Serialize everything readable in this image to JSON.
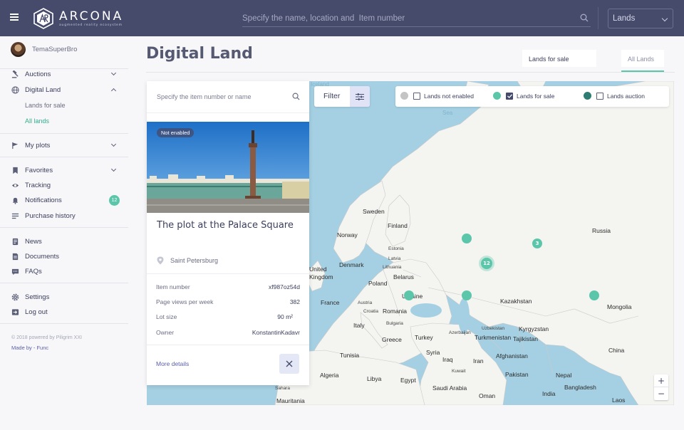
{
  "header": {
    "logo_name": "ARCONA",
    "logo_tagline": "augmented reality ecosystem",
    "search_placeholder": "Specify the name, location and  Item number",
    "lands_select": "Lands"
  },
  "user": {
    "name": "TemaSuperBro"
  },
  "sidebar": {
    "auctions": "Auctions",
    "digital_land": "Digital Land",
    "lands_for_sale": "Lands for sale",
    "all_lands": "All lands",
    "my_plots": "My plots",
    "favorites": "Favorites",
    "tracking": "Tracking",
    "notifications": "Notifications",
    "notifications_count": "12",
    "purchase_history": "Purchase history",
    "news": "News",
    "documents": "Documents",
    "faqs": "FAQs",
    "settings": "Settings",
    "log_out": "Log out",
    "copyright": "© 2018 powered by Piligrim XXI",
    "made_by_prefix": "Made by  -",
    "made_by": "Func"
  },
  "page": {
    "title": "Digital Land",
    "tab_for_sale": "Lands for sale",
    "tab_all": "All Lands"
  },
  "panel": {
    "search_placeholder": "Specify the item number or name",
    "badge": "Not enabled",
    "title": "The plot at the Palace Square",
    "location": "Saint Petersburg",
    "rows": [
      {
        "label": "Item number",
        "value": "xf987oz54d"
      },
      {
        "label": "Page views per week",
        "value": "382"
      },
      {
        "label": "Lot size",
        "value": "90  m²"
      },
      {
        "label": "Owner",
        "value": "KonstantinKadavr"
      }
    ],
    "more_details": "More details"
  },
  "filter": {
    "label": "Filter"
  },
  "legend": {
    "not_enabled": "Lands not enabled",
    "for_sale": "Lands for sale",
    "auction": "Lands auction",
    "colors": {
      "not_enabled": "#c4c4c4",
      "for_sale": "#5cc6aa",
      "auction": "#2f7d72"
    }
  },
  "map": {
    "labels": {
      "sweden": "Sweden",
      "finland": "Finland",
      "norway": "Norway",
      "estonia": "Estonia",
      "latvia": "Latvia",
      "lithuania": "Lithuania",
      "denmark": "Denmark",
      "belarus": "Belarus",
      "united": "United",
      "kingdom": "Kingdom",
      "poland": "Poland",
      "ukraine": "Ukraine",
      "france": "France",
      "austria": "Austria",
      "croatia": "Croatia",
      "romania": "Romania",
      "italy": "Italy",
      "bulgaria": "Bulgaria",
      "greece": "Greece",
      "turkey": "Turkey",
      "tunisia": "Tunisia",
      "syria": "Syria",
      "iraq": "Iraq",
      "iran": "Iran",
      "kuwait": "Kuwait",
      "azerbaijan": "Azerbaijan",
      "turkmenistan": "Turkmenistan",
      "tajikistan": "Tajikistan",
      "kyrgyzstan": "Kyrgyzstan",
      "uzbekistan": "Uzbekistan",
      "kazakhstan": "Kazakhstan",
      "russia": "Russia",
      "mongolia": "Mongolia",
      "china": "China",
      "afghanistan": "Afghanistan",
      "pakistan": "Pakistan",
      "nepal": "Nepal",
      "bangladesh": "Bangladesh",
      "india": "India",
      "oman": "Oman",
      "saudi": "Saudi Arabia",
      "egypt": "Egypt",
      "libya": "Libya",
      "algeria": "Algeria",
      "sahara": "Sahara",
      "mauritania": "Mauritania",
      "laos": "Laos",
      "sea": "Sea",
      "iceland": "Iceland"
    },
    "clusters": [
      "3",
      "12"
    ]
  },
  "zoom": {
    "in": "+",
    "out": "−"
  }
}
